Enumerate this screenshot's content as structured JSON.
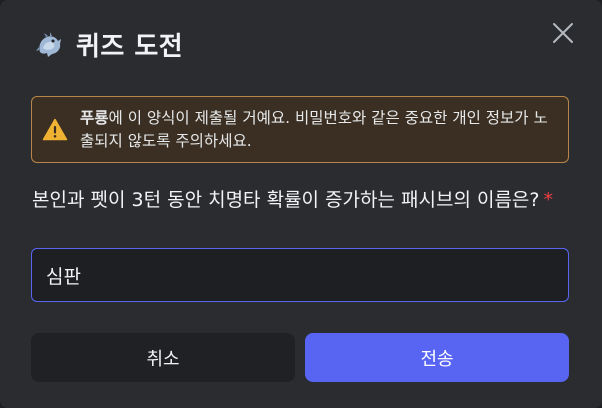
{
  "modal": {
    "title": "퀴즈 도전",
    "icon": "dragon-emoji-icon",
    "close_icon": "close-icon"
  },
  "notice": {
    "icon": "warning-icon",
    "bold_name": "푸룡",
    "text": "에 이 양식이 제출될 거예요. 비밀번호와 같은 중요한 개인 정보가 노출되지 않도록 주의하세요.",
    "color_border": "#b8864c",
    "color_bg": "#3a2f22"
  },
  "question": {
    "label": "본인과 펫이 3턴 동안 치명타 확률이 증가하는 패시브의 이름은?",
    "required_mark": "*"
  },
  "answer": {
    "value": "심판"
  },
  "buttons": {
    "cancel_label": "취소",
    "submit_label": "전송"
  },
  "colors": {
    "accent": "#5865f2",
    "required": "#f23f43",
    "background": "#2b2c30"
  }
}
